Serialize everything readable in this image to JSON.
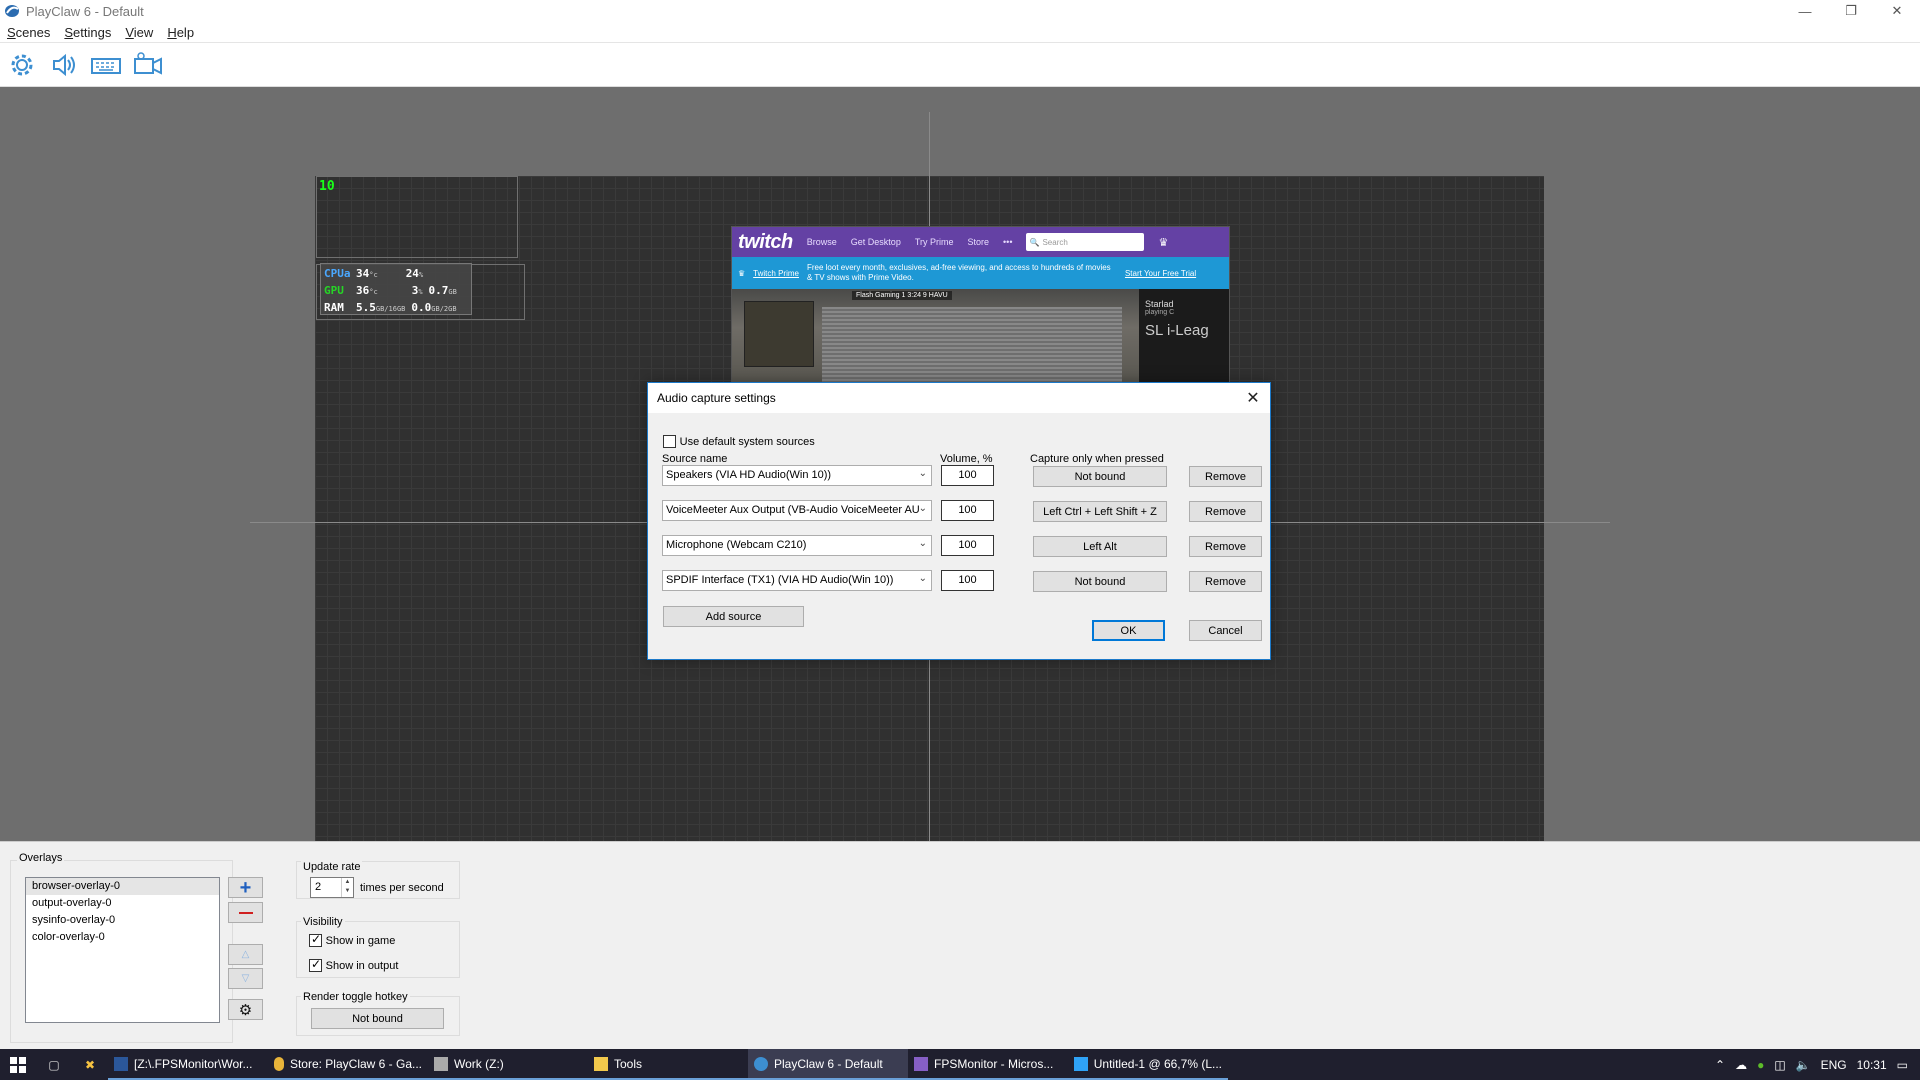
{
  "window": {
    "title": "PlayClaw 6 - Default"
  },
  "menu": [
    "Scenes",
    "Settings",
    "View",
    "Help"
  ],
  "toolbar": [
    "settings-gear",
    "speaker",
    "keyboard",
    "video-camera"
  ],
  "canvas": {
    "fps_value": "10",
    "sysinfo": {
      "cpu_label": "CPUa",
      "cpu_temp": "34",
      "cpu_temp_unit": "°c",
      "cpu_load": "24",
      "cpu_load_unit": "%",
      "gpu_label": "GPU",
      "gpu_temp": "36",
      "gpu_temp_unit": "°c",
      "gpu_load": "3",
      "gpu_load_unit": "%",
      "gpu_mem": "0.7",
      "gpu_mem_unit": "GB",
      "ram_label": "RAM",
      "ram_used": "5.5",
      "ram_used_unit": "GB/16GB",
      "ram_other": "0.0",
      "ram_other_unit": "GB/2GB"
    },
    "browser": {
      "logo": "twitch",
      "nav": [
        "Browse",
        "Get Desktop",
        "Try Prime",
        "Store",
        "•••"
      ],
      "search_placeholder": "Search",
      "banner_link": "Twitch Prime",
      "banner_text": "Free loot every month, exclusives, ad-free viewing, and access to hundreds of movies & TV shows with Prime Video.",
      "banner_cta": "Start Your Free Trial",
      "hud": "Flash Gaming   1   3:24   9   HAVU",
      "channel": "Starlad",
      "channel_sub": "playing C",
      "stream_title": "SL i-Leag"
    }
  },
  "dialog": {
    "title": "Audio capture settings",
    "use_default_label": "Use default system sources",
    "use_default_checked": false,
    "col_source": "Source name",
    "col_volume": "Volume, %",
    "col_capture": "Capture only when pressed",
    "rows": [
      {
        "source": "Speakers (VIA HD Audio(Win 10))",
        "volume": "100",
        "hotkey": "Not bound",
        "remove": "Remove"
      },
      {
        "source": "VoiceMeeter Aux Output (VB-Audio VoiceMeeter AU",
        "volume": "100",
        "hotkey": "Left Ctrl + Left Shift + Z",
        "remove": "Remove"
      },
      {
        "source": "Microphone (Webcam C210)",
        "volume": "100",
        "hotkey": "Left Alt",
        "remove": "Remove"
      },
      {
        "source": "SPDIF Interface (TX1) (VIA HD Audio(Win 10))",
        "volume": "100",
        "hotkey": "Not bound",
        "remove": "Remove"
      }
    ],
    "add_source": "Add source",
    "ok": "OK",
    "cancel": "Cancel"
  },
  "panel": {
    "overlays_title": "Overlays",
    "overlays": [
      "browser-overlay-0",
      "output-overlay-0",
      "sysinfo-overlay-0",
      "color-overlay-0"
    ],
    "selected_overlay": 0,
    "update_rate_title": "Update rate",
    "update_rate_value": "2",
    "update_rate_suffix": "times per second",
    "visibility_title": "Visibility",
    "show_in_game": "Show in game",
    "show_in_game_checked": true,
    "show_in_output": "Show in output",
    "show_in_output_checked": true,
    "render_toggle_title": "Render toggle hotkey",
    "render_toggle_value": "Not bound"
  },
  "taskbar": {
    "items": [
      "[Z:\\.FPSMonitor\\Wor...",
      "Store: PlayClaw 6 - Ga...",
      "Work (Z:)",
      "Tools",
      "PlayClaw 6 - Default",
      "FPSMonitor - Micros...",
      "Untitled-1 @ 66,7% (L..."
    ],
    "active_index": 4,
    "lang": "ENG",
    "clock": "10:31"
  },
  "colors": {
    "accent": "#0078d7",
    "twitch": "#6441a4",
    "banner": "#1e98d5",
    "fps": "#19ff19"
  }
}
